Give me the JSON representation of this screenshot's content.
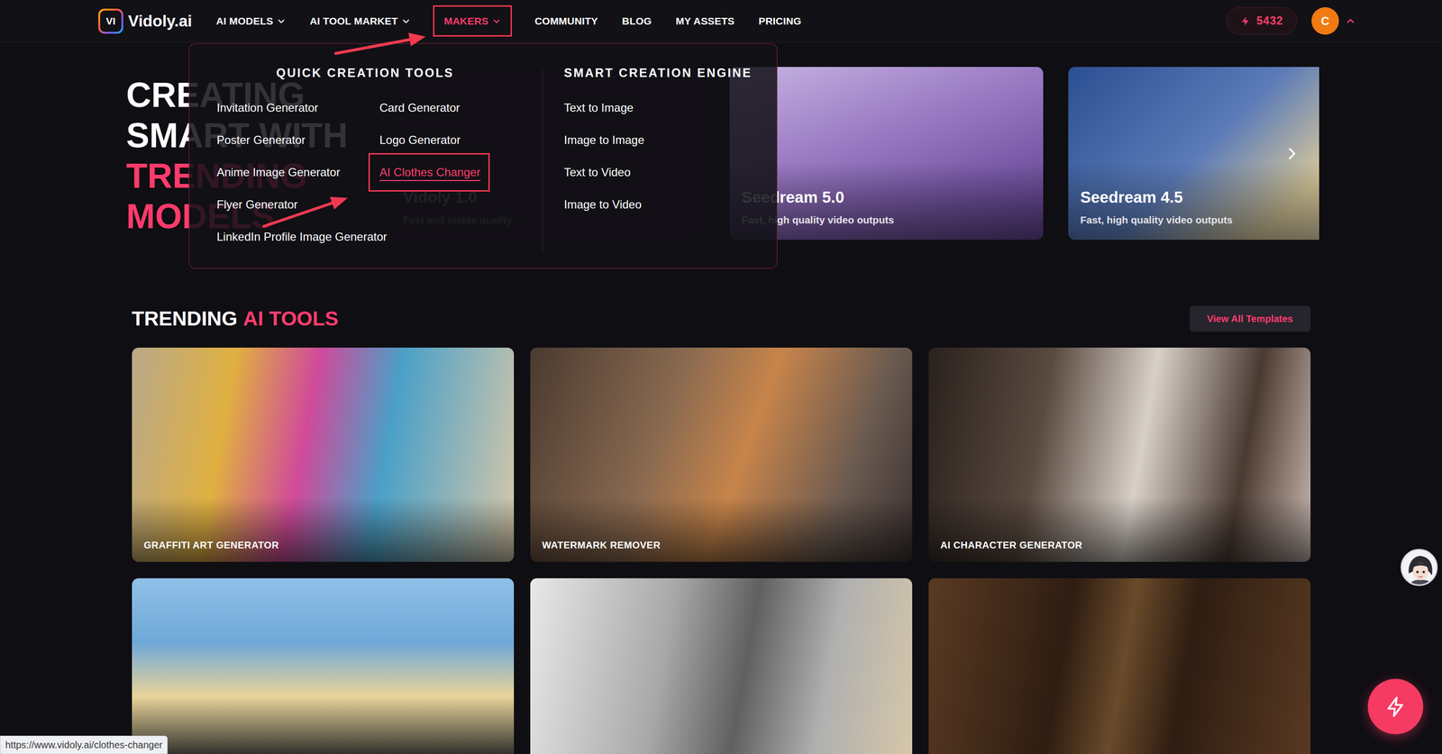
{
  "logo": {
    "mark": "VI",
    "name": "Vidoly.ai"
  },
  "nav": [
    {
      "label": "AI MODELS",
      "dropdown": true,
      "selected": false
    },
    {
      "label": "AI TOOL MARKET",
      "dropdown": true,
      "selected": false
    },
    {
      "label": "MAKERS",
      "dropdown": true,
      "selected": true
    },
    {
      "label": "COMMUNITY",
      "dropdown": false,
      "selected": false
    },
    {
      "label": "BLOG",
      "dropdown": false,
      "selected": false
    },
    {
      "label": "MY ASSETS",
      "dropdown": false,
      "selected": false
    },
    {
      "label": "PRICING",
      "dropdown": false,
      "selected": false
    }
  ],
  "credits": "5432",
  "user": {
    "initial": "C",
    "expanded": true
  },
  "menu": {
    "expanded": true,
    "sections": [
      {
        "title": "QUICK CREATION TOOLS",
        "columns": [
          [
            {
              "label": "Invitation Generator",
              "selected": false
            },
            {
              "label": "Poster Generator",
              "selected": false
            },
            {
              "label": "Anime Image Generator",
              "selected": false
            },
            {
              "label": "Flyer Generator",
              "selected": false
            },
            {
              "label": "LinkedIn Profile Image Generator",
              "selected": false
            }
          ],
          [
            {
              "label": "Card Generator",
              "selected": false
            },
            {
              "label": "Logo Generator",
              "selected": false
            },
            {
              "label": "AI Clothes Changer",
              "selected": true
            }
          ]
        ]
      },
      {
        "title": "SMART CREATION ENGINE",
        "columns": [
          [
            {
              "label": "Text to Image",
              "selected": false
            },
            {
              "label": "Image to Image",
              "selected": false
            },
            {
              "label": "Text to Video",
              "selected": false
            },
            {
              "label": "Image to Video",
              "selected": false
            }
          ]
        ]
      }
    ]
  },
  "hero": {
    "lines": [
      {
        "text": "CREATING",
        "accent": false
      },
      {
        "text": "SMART WITH",
        "accent": false
      },
      {
        "text": "TRENDING",
        "accent": true
      },
      {
        "text": "MODELS",
        "accent": true
      }
    ]
  },
  "carousel": {
    "slides": [
      {
        "title": "Vidoly 1.0",
        "subtitle": "Fast and stable quality"
      },
      {
        "title": "Seedream 5.0",
        "subtitle": "Fast, high quality video outputs"
      },
      {
        "title": "Seedream 4.5",
        "subtitle": "Fast, high quality video outputs"
      }
    ]
  },
  "trending": {
    "title": "TRENDING",
    "accent": "AI TOOLS",
    "button": "View All Templates",
    "cards": [
      {
        "label": "GRAFFITI ART GENERATOR"
      },
      {
        "label": "WATERMARK REMOVER"
      },
      {
        "label": "AI CHARACTER GENERATOR"
      },
      {},
      {},
      {}
    ]
  },
  "status_url": "https://www.vidoly.ai/clothes-changer"
}
